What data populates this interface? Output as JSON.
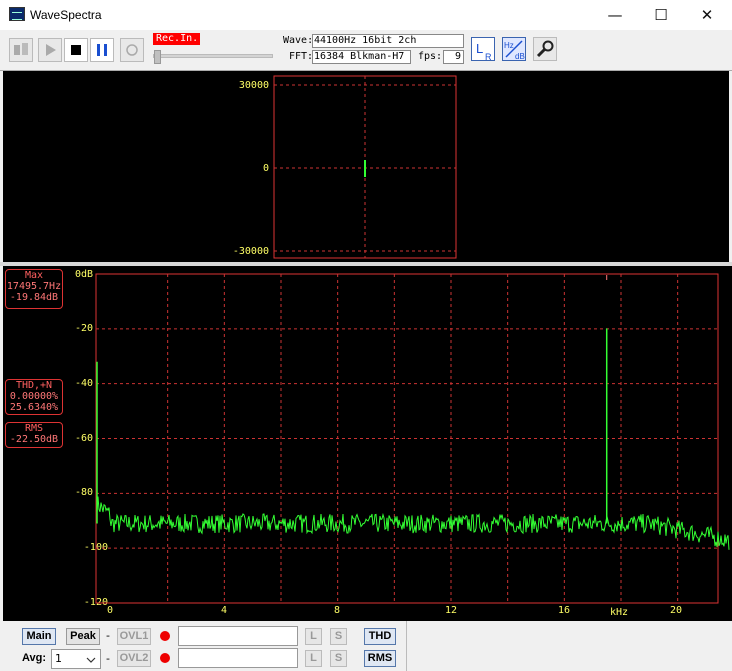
{
  "window": {
    "title": "WaveSpectra",
    "minimize_glyph": "—",
    "maximize_glyph": "☐",
    "close_glyph": "✕"
  },
  "toolbar": {
    "rec_in_label": "Rec.In.",
    "wave_label": "Wave:",
    "wave_value": "44100Hz 16bit 2ch",
    "fft_label": "FFT:",
    "fft_value": "16384 Blkman-H7",
    "fps_label": "fps:",
    "fps_value": "9",
    "icons": [
      "record-in-icon",
      "play-icon",
      "stop-icon",
      "pause-icon",
      "record-icon",
      "lr-channel-icon",
      "hz-db-scale-icon",
      "settings-wrench-icon"
    ],
    "lr_label": "L",
    "lr_sub": "R",
    "hzdb_top": "Hz",
    "hzdb_bottom": "dB"
  },
  "scope": {
    "y_ticks": [
      "30000",
      "0",
      "-30000"
    ],
    "colors": {
      "frame": "#dd3333",
      "grid": "#cc3333",
      "signal": "#33ff33"
    }
  },
  "spectrum": {
    "max_box": {
      "title": "Max",
      "freq": "17495.7Hz",
      "level": "-19.84dB"
    },
    "thd_box": {
      "title": "THD,+N",
      "thd": "0.00000%",
      "thdn": "25.6340%"
    },
    "rms_box": {
      "title": "RMS",
      "value": "-22.50dB"
    },
    "y_ticks": [
      "0dB",
      "-20",
      "-40",
      "-60",
      "-80",
      "-100",
      "-120"
    ],
    "x_ticks": [
      "0",
      "4",
      "8",
      "12",
      "16",
      "20"
    ],
    "x_unit": "kHz",
    "colors": {
      "frame": "#dd3333",
      "grid": "#cc3333",
      "signal": "#33ff33",
      "labels": "#ffff66"
    }
  },
  "chart_data": {
    "type": "line",
    "x_unit": "kHz",
    "xlim": [
      0,
      22
    ],
    "ylim": [
      -120,
      0
    ],
    "noise_floor_db": -91,
    "peaks": [
      {
        "x": 0.05,
        "y": -32
      },
      {
        "x": 17.4957,
        "y": -19.84
      }
    ]
  },
  "bottom": {
    "main_label": "Main",
    "peak_label": "Peak",
    "dash": "-",
    "ovl1_label": "OVL1",
    "ovl2_label": "OVL2",
    "l_label": "L",
    "s_label": "S",
    "thd_label": "THD",
    "rms_label": "RMS",
    "avg_label": "Avg:",
    "avg_value": "1"
  }
}
